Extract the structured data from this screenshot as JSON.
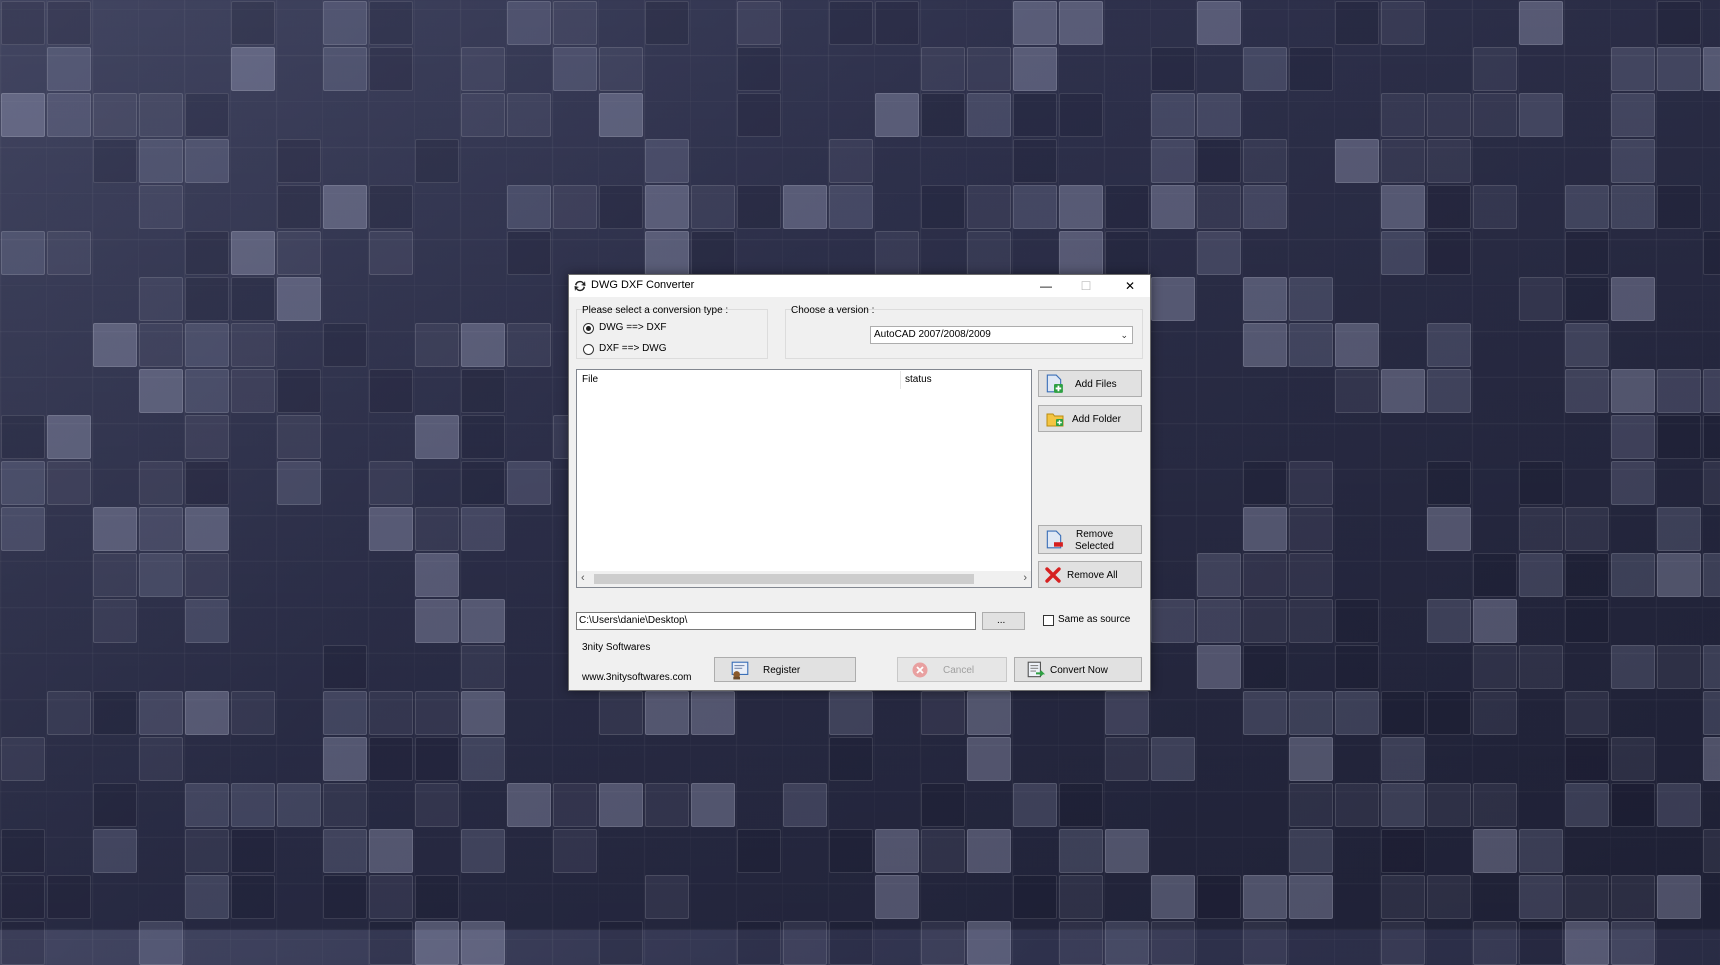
{
  "window": {
    "title": "DWG DXF Converter",
    "controls": {
      "minimize": "—",
      "maximize": "☐",
      "close": "✕"
    }
  },
  "conversion": {
    "label": "Please select a conversion type :",
    "options": [
      {
        "label": "DWG ==> DXF",
        "selected": true
      },
      {
        "label": "DXF   ==> DWG",
        "selected": false
      }
    ]
  },
  "version": {
    "label": "Choose a version :",
    "selected": "AutoCAD 2007/2008/2009"
  },
  "file_list": {
    "columns": [
      "File",
      "status"
    ],
    "rows": []
  },
  "buttons": {
    "add_files": "Add Files",
    "add_folder": "Add Folder",
    "remove_selected_line1": "Remove",
    "remove_selected_line2": "Selected",
    "remove_all": "Remove All",
    "browse": "...",
    "register": "Register",
    "cancel": "Cancel",
    "convert_now": "Convert Now"
  },
  "output": {
    "path": "C:\\Users\\danie\\Desktop\\",
    "same_as_source_label": "Same as source",
    "same_as_source_checked": false
  },
  "footer": {
    "company": "3nity Softwares",
    "website": "www.3nitysoftwares.com"
  },
  "colors": {
    "accent_blue": "#1e6fd9",
    "remove_red": "#d62020",
    "add_green": "#2ea043"
  }
}
